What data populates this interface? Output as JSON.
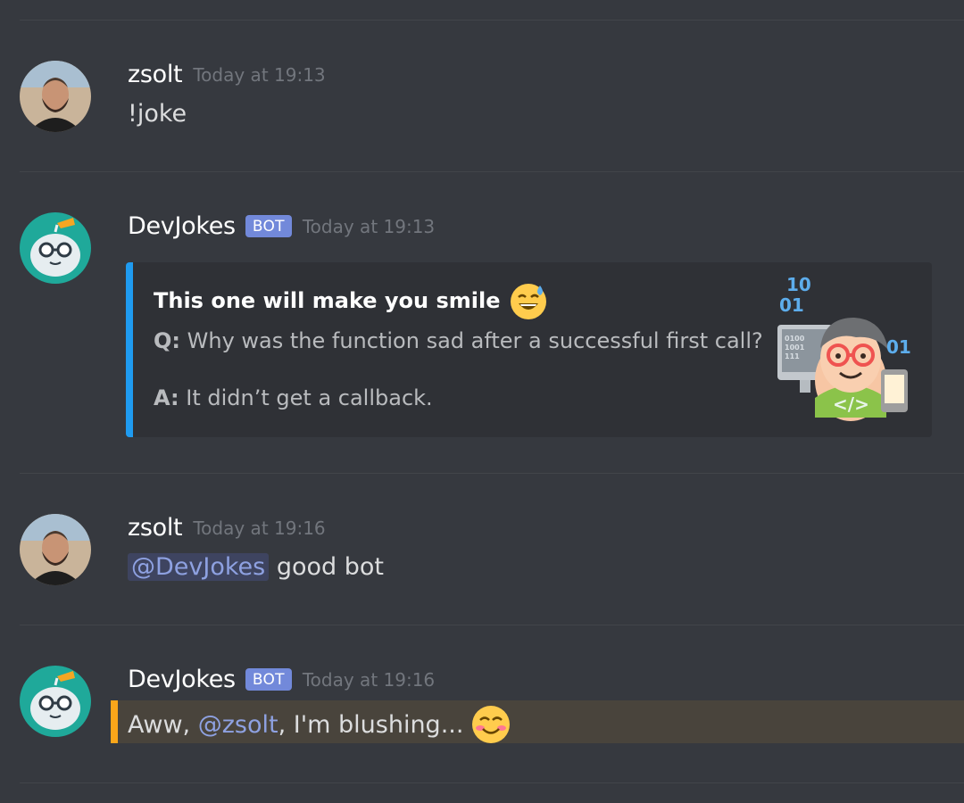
{
  "messages": [
    {
      "author": "zsolt",
      "timestamp": "Today at 19:13",
      "text": "!joke"
    },
    {
      "author": "DevJokes",
      "bot_tag": "BOT",
      "timestamp": "Today at 19:13",
      "embed": {
        "title": "This one will make you smile",
        "title_emoji": "sweat-smile-emoji",
        "q_label": "Q:",
        "question": "Why was the function sad after a successful first call?",
        "a_label": "A:",
        "answer": "It didn’t get a callback.",
        "accent_color": "#1f9bf0",
        "thumbnail_texts": [
          "10",
          "01",
          "0100",
          "1001",
          "111",
          "01",
          "</>"
        ]
      }
    },
    {
      "author": "zsolt",
      "timestamp": "Today at 19:16",
      "mention": "@DevJokes",
      "text": "good bot"
    },
    {
      "author": "DevJokes",
      "bot_tag": "BOT",
      "timestamp": "Today at 19:16",
      "text_before": "Aww, ",
      "mention": "@zsolt",
      "text_after": ", I'm blushing...",
      "emoji": "blush-emoji",
      "highlight_color": "#faa61a"
    }
  ],
  "colors": {
    "background": "#36393f",
    "bot_badge": "#7289da",
    "mention": "#8ea1e1"
  }
}
